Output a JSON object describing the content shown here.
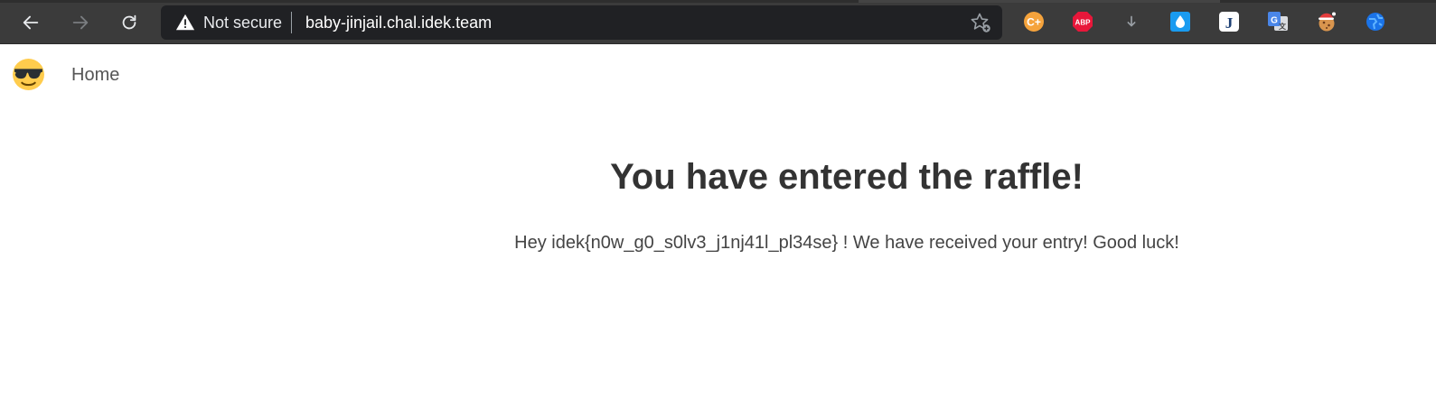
{
  "browser": {
    "security_label": "Not secure",
    "url": "baby-jinjail.chal.idek.team",
    "extensions": [
      {
        "name": "coupon-extension",
        "label": "C+",
        "color": "#f5a33c"
      },
      {
        "name": "adblock-plus",
        "label": "ABP",
        "color": "#e8173a"
      },
      {
        "name": "download-arrow",
        "label": "↓",
        "color": "#9aa0a6"
      },
      {
        "name": "raindrop-extension",
        "label": "💧",
        "color": "#1a9bf0"
      },
      {
        "name": "j-extension",
        "label": "J",
        "color": "#1c4a8a"
      },
      {
        "name": "google-translate",
        "label": "G",
        "color": "#4a86e8"
      },
      {
        "name": "cookie-santa-extension",
        "label": "🍪",
        "color": "#c44"
      },
      {
        "name": "globe-extension",
        "label": "",
        "color": "#1a73e8"
      }
    ]
  },
  "nav": {
    "home_label": "Home"
  },
  "main": {
    "heading": "You have entered the raffle!",
    "message": "Hey idek{n0w_g0_s0lv3_j1nj41l_pl34se} ! We have received your entry! Good luck!"
  }
}
